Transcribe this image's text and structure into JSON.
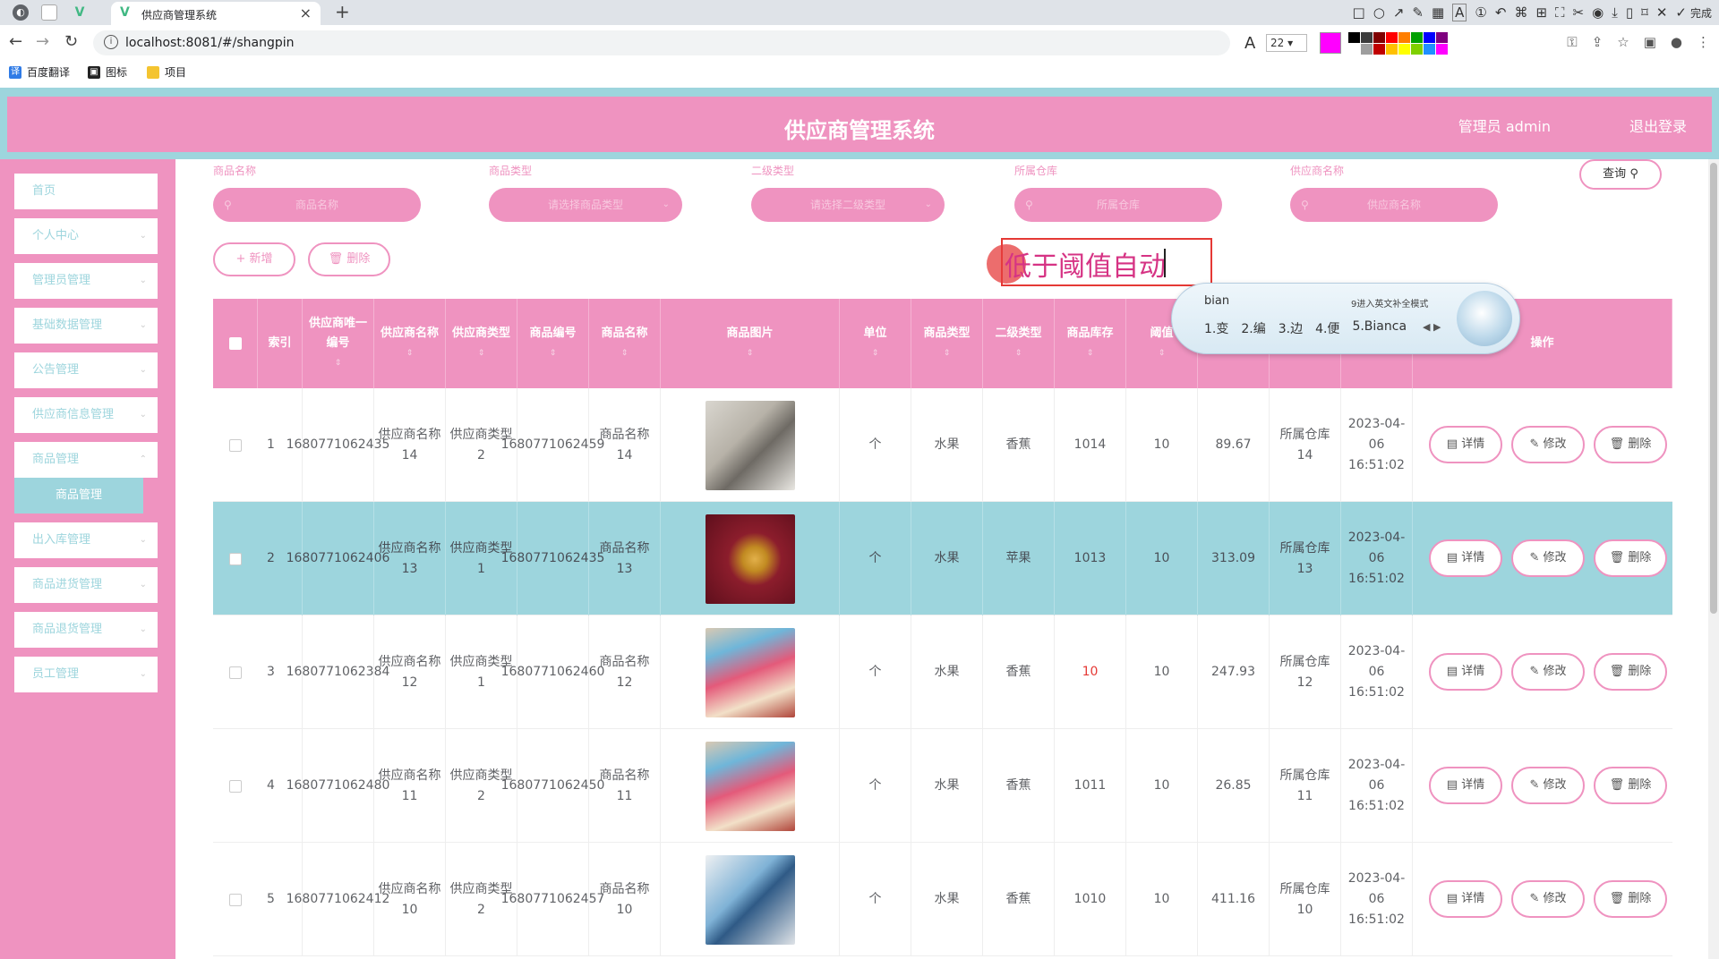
{
  "browser": {
    "tab_title": "供应商管理系统",
    "url": "localhost:8081/#/shangpin",
    "font_size": "22",
    "current_color": "#ff00ff",
    "done_label": "完成",
    "bookmarks": [
      {
        "label": "百度翻译",
        "icon": "translate-icon"
      },
      {
        "label": "图标",
        "icon": "image-icon"
      },
      {
        "label": "项目",
        "icon": "folder-icon"
      }
    ],
    "palette": [
      "#000000",
      "#3c3c3c",
      "#7f0000",
      "#ff0000",
      "#ff7f00",
      "#00a000",
      "#0000ff",
      "#7f007f",
      "#ffffff",
      "#9e9e9e",
      "#c00000",
      "#ffc000",
      "#ffff00",
      "#7fd000",
      "#2090ff",
      "#ff00ff"
    ]
  },
  "header": {
    "title": "供应商管理系统",
    "user": "管理员 admin",
    "logout": "退出登录"
  },
  "sidebar": {
    "items": [
      {
        "label": "首页"
      },
      {
        "label": "个人中心"
      },
      {
        "label": "管理员管理"
      },
      {
        "label": "基础数据管理"
      },
      {
        "label": "公告管理"
      },
      {
        "label": "供应商信息管理"
      },
      {
        "label": "商品管理"
      },
      {
        "label": "出入库管理"
      },
      {
        "label": "商品进货管理"
      },
      {
        "label": "商品退货管理"
      },
      {
        "label": "员工管理"
      }
    ],
    "active_sub": "商品管理"
  },
  "filters": {
    "name_label": "商品名称",
    "name_placeholder": "商品名称",
    "type_label": "商品类型",
    "type_placeholder": "请选择商品类型",
    "subtype_label": "二级类型",
    "subtype_placeholder": "请选择二级类型",
    "warehouse_label": "所属仓库",
    "warehouse_placeholder": "所属仓库",
    "supplier_label": "供应商名称",
    "supplier_placeholder": "供应商名称",
    "query": "查询"
  },
  "toolbar": {
    "add": "+ 新增",
    "delete": "删除"
  },
  "annotation": {
    "text": "低于阈值自动"
  },
  "ime": {
    "input": "bian",
    "hint": "9进入英文补全模式",
    "candidates": [
      "1.变",
      "2.编",
      "3.边",
      "4.便",
      "5.Bianca"
    ]
  },
  "table": {
    "headers": [
      "索引",
      "供应商唯一编号",
      "供应商名称",
      "供应商类型",
      "商品编号",
      "商品名称",
      "商品图片",
      "单位",
      "商品类型",
      "二级类型",
      "商品库存",
      "阈值",
      "",
      "",
      "",
      "操作"
    ],
    "rows": [
      {
        "index": "1",
        "supplier_no": "1680771062435",
        "supplier_name": "供应商名称14",
        "supplier_type": "供应商类型2",
        "goods_no": "1680771062459",
        "goods_name": "商品名称14",
        "unit": "个",
        "type": "水果",
        "subtype": "香蕉",
        "stock": "1014",
        "threshold": "10",
        "price": "89.67",
        "warehouse": "所属仓库14",
        "time": "2023-04-06 16:51:02",
        "low": false
      },
      {
        "index": "2",
        "supplier_no": "1680771062406",
        "supplier_name": "供应商名称13",
        "supplier_type": "供应商类型1",
        "goods_no": "1680771062435",
        "goods_name": "商品名称13",
        "unit": "个",
        "type": "水果",
        "subtype": "苹果",
        "stock": "1013",
        "threshold": "10",
        "price": "313.09",
        "warehouse": "所属仓库13",
        "time": "2023-04-06 16:51:02",
        "low": false
      },
      {
        "index": "3",
        "supplier_no": "1680771062384",
        "supplier_name": "供应商名称12",
        "supplier_type": "供应商类型1",
        "goods_no": "1680771062460",
        "goods_name": "商品名称12",
        "unit": "个",
        "type": "水果",
        "subtype": "香蕉",
        "stock": "10",
        "threshold": "10",
        "price": "247.93",
        "warehouse": "所属仓库12",
        "time": "2023-04-06 16:51:02",
        "low": true
      },
      {
        "index": "4",
        "supplier_no": "1680771062480",
        "supplier_name": "供应商名称11",
        "supplier_type": "供应商类型2",
        "goods_no": "1680771062450",
        "goods_name": "商品名称11",
        "unit": "个",
        "type": "水果",
        "subtype": "香蕉",
        "stock": "1011",
        "threshold": "10",
        "price": "26.85",
        "warehouse": "所属仓库11",
        "time": "2023-04-06 16:51:02",
        "low": false
      },
      {
        "index": "5",
        "supplier_no": "1680771062412",
        "supplier_name": "供应商名称10",
        "supplier_type": "供应商类型2",
        "goods_no": "1680771062457",
        "goods_name": "商品名称10",
        "unit": "个",
        "type": "水果",
        "subtype": "香蕉",
        "stock": "1010",
        "threshold": "10",
        "price": "411.16",
        "warehouse": "所属仓库10",
        "time": "2023-04-06 16:51:02",
        "low": false
      }
    ],
    "actions": [
      "详情",
      "修改",
      "删除"
    ]
  },
  "colors": {
    "primary_pink": "#ef93c0",
    "accent_teal": "#9dd5dd",
    "alert_red": "#e53935"
  }
}
